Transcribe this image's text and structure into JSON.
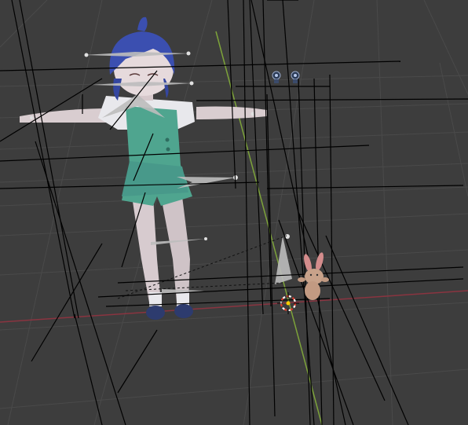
{
  "app": {
    "name": "3D viewport",
    "view": "perspective"
  },
  "colors": {
    "background": "#3d3d3d",
    "grid_line": "#4a4a4a",
    "x_axis": "#8a3440",
    "y_axis": "#7da33a",
    "bone_lines": "#000000",
    "bone_shape": "#bdbdbd",
    "hair": "#3b4fb0",
    "outfit": "#4fa58f",
    "skin": "#d9cdd0",
    "shirt": "#e8e8ec",
    "shoes": "#2d3b6e",
    "cursor_red": "#d93b2b",
    "cursor_white": "#ffffff"
  },
  "objects": [
    {
      "id": "character",
      "kind": "armature-mesh",
      "icon": "character-model"
    },
    {
      "id": "plush",
      "kind": "mesh",
      "icon": "bunny-plush"
    },
    {
      "id": "bone-gizmo",
      "kind": "bone",
      "icon": "bone-octahedral"
    },
    {
      "id": "lights",
      "kind": "light",
      "icon": "light-icon"
    },
    {
      "id": "cursor",
      "kind": "3d-cursor",
      "icon": "3d-cursor"
    }
  ]
}
